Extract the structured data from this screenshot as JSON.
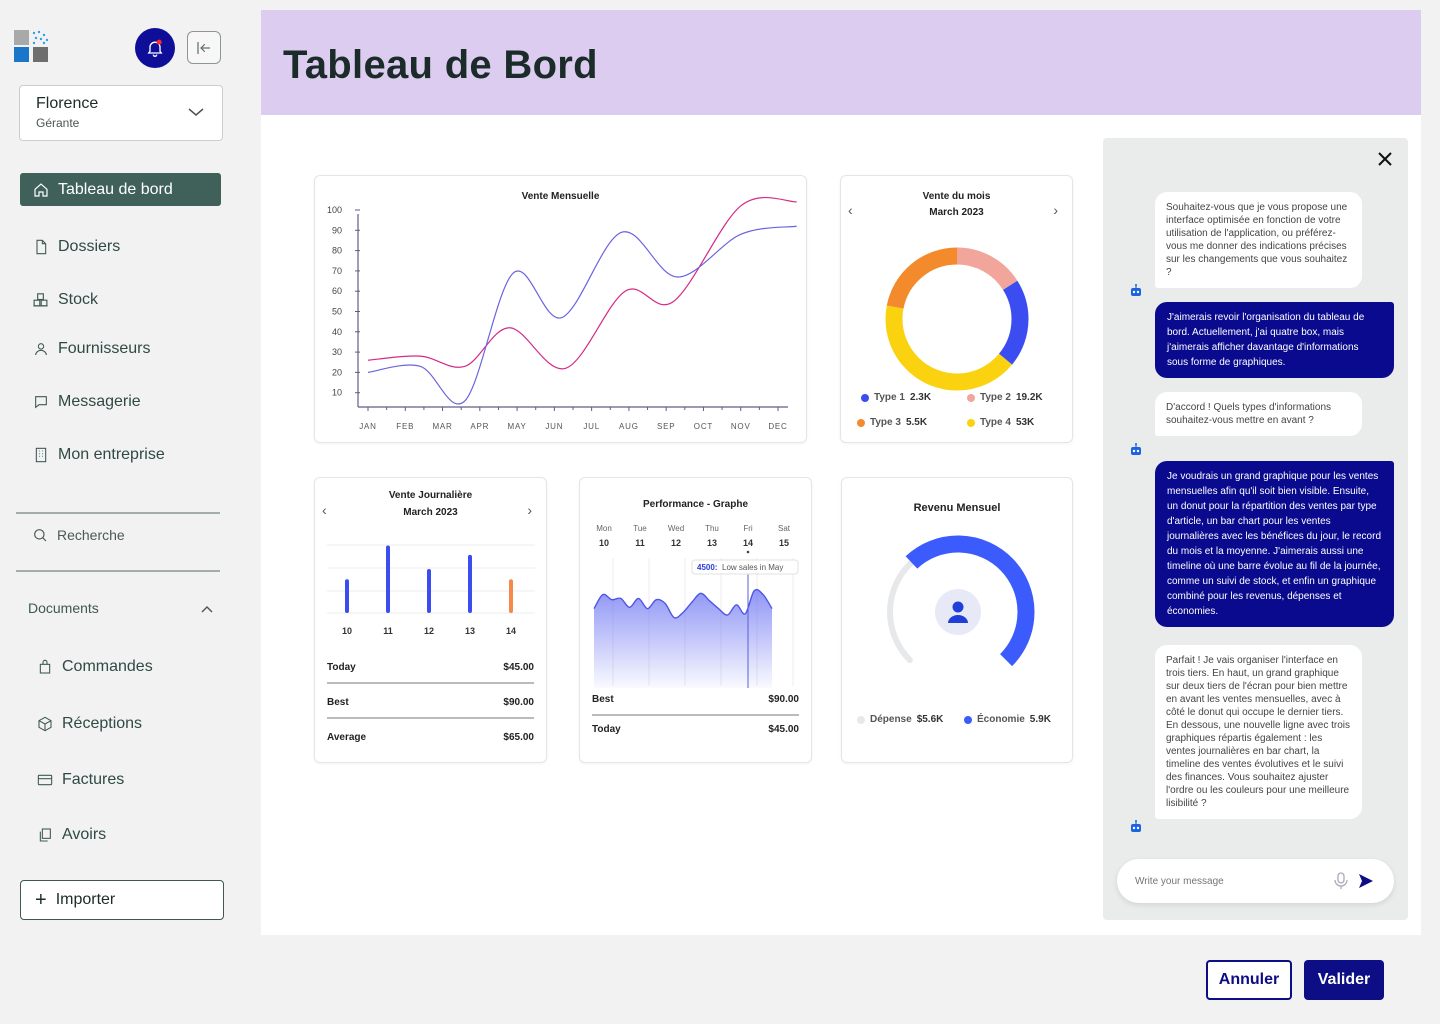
{
  "sidebar": {
    "user": {
      "name": "Florence",
      "role": "Gérante"
    },
    "nav": [
      {
        "label": "Tableau de bord",
        "icon": "home-icon",
        "active": true
      },
      {
        "label": "Dossiers",
        "icon": "file-icon"
      },
      {
        "label": "Stock",
        "icon": "boxes-icon"
      },
      {
        "label": "Fournisseurs",
        "icon": "user-icon"
      },
      {
        "label": "Messagerie",
        "icon": "message-icon"
      },
      {
        "label": "Mon entreprise",
        "icon": "building-icon"
      }
    ],
    "search_label": "Recherche",
    "documents_label": "Documents",
    "documents": [
      {
        "label": "Commandes",
        "icon": "bag-icon"
      },
      {
        "label": "Réceptions",
        "icon": "package-icon"
      },
      {
        "label": "Factures",
        "icon": "card-icon"
      },
      {
        "label": "Avoirs",
        "icon": "copy-icon"
      }
    ],
    "import_label": "Importer"
  },
  "header": {
    "title": "Tableau de Bord"
  },
  "cards": {
    "monthly_sales": {
      "title": "Vente Mensuelle"
    },
    "month_donut": {
      "title": "Vente du mois",
      "subtitle": "March 2023"
    },
    "daily_sales": {
      "title": "Vente Journalière",
      "subtitle": "March 2023",
      "rows": [
        {
          "label": "Today",
          "value": "$45.00"
        },
        {
          "label": "Best",
          "value": "$90.00"
        },
        {
          "label": "Average",
          "value": "$65.00"
        }
      ]
    },
    "performance": {
      "title": "Performance - Graphe",
      "days": [
        {
          "name": "Mon",
          "num": "10"
        },
        {
          "name": "Tue",
          "num": "11"
        },
        {
          "name": "Wed",
          "num": "12"
        },
        {
          "name": "Thu",
          "num": "13"
        },
        {
          "name": "Fri",
          "num": "14"
        },
        {
          "name": "Sat",
          "num": "15"
        }
      ],
      "tooltip_value": "4500:",
      "tooltip_text": "Low sales in May",
      "rows": [
        {
          "label": "Best",
          "value": "$90.00"
        },
        {
          "label": "Today",
          "value": "$45.00"
        }
      ]
    },
    "revenue": {
      "title": "Revenu Mensuel",
      "legend": [
        {
          "label": "Dépense",
          "value": "$5.6K",
          "color": "#e6e8ea"
        },
        {
          "label": "Économie",
          "value": "5.9K",
          "color": "#3b5bfd"
        }
      ]
    }
  },
  "chart_data": [
    {
      "type": "line",
      "title": "Vente Mensuelle",
      "categories": [
        "JAN",
        "FEB",
        "MAR",
        "APR",
        "MAY",
        "JUN",
        "JUL",
        "AUG",
        "SEP",
        "OCT",
        "NOV",
        "DEC"
      ],
      "ylim": [
        0,
        100
      ],
      "yticks": [
        10,
        20,
        30,
        40,
        50,
        60,
        70,
        80,
        90,
        100
      ],
      "series": [
        {
          "values": [
            26,
            28,
            23,
            42,
            22,
            60,
            55,
            102,
            104
          ],
          "color": "#d42a86",
          "x": [
            0,
            1.4,
            2.6,
            3.8,
            5.3,
            6.9,
            8.2,
            10,
            11.5
          ]
        },
        {
          "values": [
            20,
            23,
            6,
            69,
            47,
            89,
            67,
            88,
            92
          ],
          "color": "#6a63e0",
          "x": [
            0,
            1.4,
            2.6,
            3.9,
            5.2,
            6.8,
            8.3,
            10,
            11.5
          ]
        }
      ]
    },
    {
      "type": "pie",
      "title": "Vente du mois",
      "donut": true,
      "series": [
        {
          "name": "Type 1",
          "label": "2.3K",
          "value": 2.3,
          "color": "#3b4df0"
        },
        {
          "name": "Type 2",
          "label": "19.2K",
          "value": 19.2,
          "color": "#f1a59b"
        },
        {
          "name": "Type 3",
          "label": "5.5K",
          "value": 5.5,
          "color": "#f38a2c"
        },
        {
          "name": "Type 4",
          "label": "53K",
          "value": 53,
          "color": "#fbd20f"
        }
      ],
      "slices_pct": [
        {
          "name": "Type 2",
          "pct": 16
        },
        {
          "name": "Type 1",
          "pct": 20
        },
        {
          "name": "Type 4",
          "pct": 42
        },
        {
          "name": "Type 3",
          "pct": 22
        }
      ]
    },
    {
      "type": "bar",
      "title": "Vente Journalière",
      "categories": [
        "10",
        "11",
        "12",
        "13",
        "14"
      ],
      "values": [
        36,
        72,
        47,
        62,
        36
      ],
      "colors": [
        "#3b4df0",
        "#3b4df0",
        "#3b4df0",
        "#3b4df0",
        "#f5884a"
      ],
      "ylim": [
        0,
        80
      ]
    },
    {
      "type": "area",
      "title": "Performance - Graphe",
      "values": [
        62,
        73,
        69,
        70,
        63,
        70,
        62,
        69,
        66,
        55,
        59,
        67,
        74,
        68,
        62,
        57,
        65,
        58,
        76,
        73,
        62
      ],
      "highlight": {
        "value": "4500",
        "label": "Low sales in May"
      },
      "color": "#6a72f2"
    },
    {
      "type": "pie",
      "title": "Revenu Mensuel",
      "series": [
        {
          "name": "Dépense",
          "label": "$5.6K",
          "color": "#e6e8ea"
        },
        {
          "name": "Économie",
          "label": "5.9K",
          "color": "#3b5bfd"
        }
      ],
      "gauge_pct": 0.66
    }
  ],
  "chat": {
    "messages": [
      {
        "from": "bot",
        "text": "Souhaitez-vous que je vous propose une interface optimisée en fonction de votre utilisation de l'application, ou préférez-vous me donner des indications précises sur les changements que vous souhaitez ?"
      },
      {
        "from": "user",
        "text": "J'aimerais revoir l'organisation du tableau de bord. Actuellement, j'ai quatre box, mais j'aimerais afficher davantage d'informations sous forme de graphiques."
      },
      {
        "from": "bot",
        "text": "D'accord ! Quels types d'informations souhaitez-vous mettre en avant ?"
      },
      {
        "from": "user",
        "text": "Je voudrais un grand graphique pour les ventes mensuelles afin qu'il soit bien visible. Ensuite, un donut pour la répartition des ventes par type d'article, un bar chart pour les ventes journalières avec les bénéfices du jour, le record du mois et la moyenne. J'aimerais aussi une timeline où une barre évolue au fil de la journée, comme un suivi de stock, et enfin un graphique combiné pour les revenus, dépenses et économies."
      },
      {
        "from": "bot",
        "text": "Parfait ! Je vais organiser l'interface en trois tiers. En haut, un grand graphique sur deux tiers de l'écran pour bien mettre en avant les ventes mensuelles, avec à côté le donut qui occupe le dernier tiers. En dessous, une nouvelle ligne avec trois graphiques répartis également : les ventes journalières en bar chart, la timeline des ventes évolutives et le suivi des finances. Vous souhaitez ajuster l'ordre ou les couleurs pour une meilleure lisibilité ?"
      }
    ],
    "input_placeholder": "Write your message"
  },
  "footer": {
    "cancel_label": "Annuler",
    "confirm_label": "Valider"
  },
  "colors": {
    "primary": "#0d0d85",
    "header_bg": "#dcccef",
    "active_nav": "#3f615a"
  }
}
